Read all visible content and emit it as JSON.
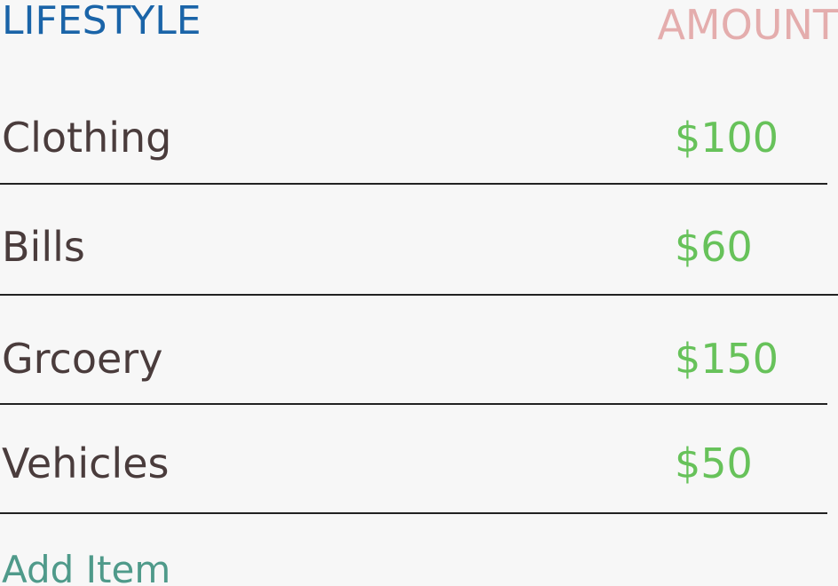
{
  "header": {
    "category_label": "LIFESTYLE",
    "amount_label": "AMOUNT"
  },
  "items": [
    {
      "name": "Clothing",
      "amount": "$100"
    },
    {
      "name": "Bills",
      "amount": "$60"
    },
    {
      "name": "Grcoery",
      "amount": "$150"
    },
    {
      "name": "Vehicles",
      "amount": "$50"
    }
  ],
  "add_item_label": "Add Item",
  "colors": {
    "header_category": "#1a64a8",
    "header_amount": "#e4adad",
    "item_text": "#4a3c3c",
    "amount_text": "#67c25a",
    "add_item": "#4f9a8a",
    "background": "#f7f7f7"
  }
}
